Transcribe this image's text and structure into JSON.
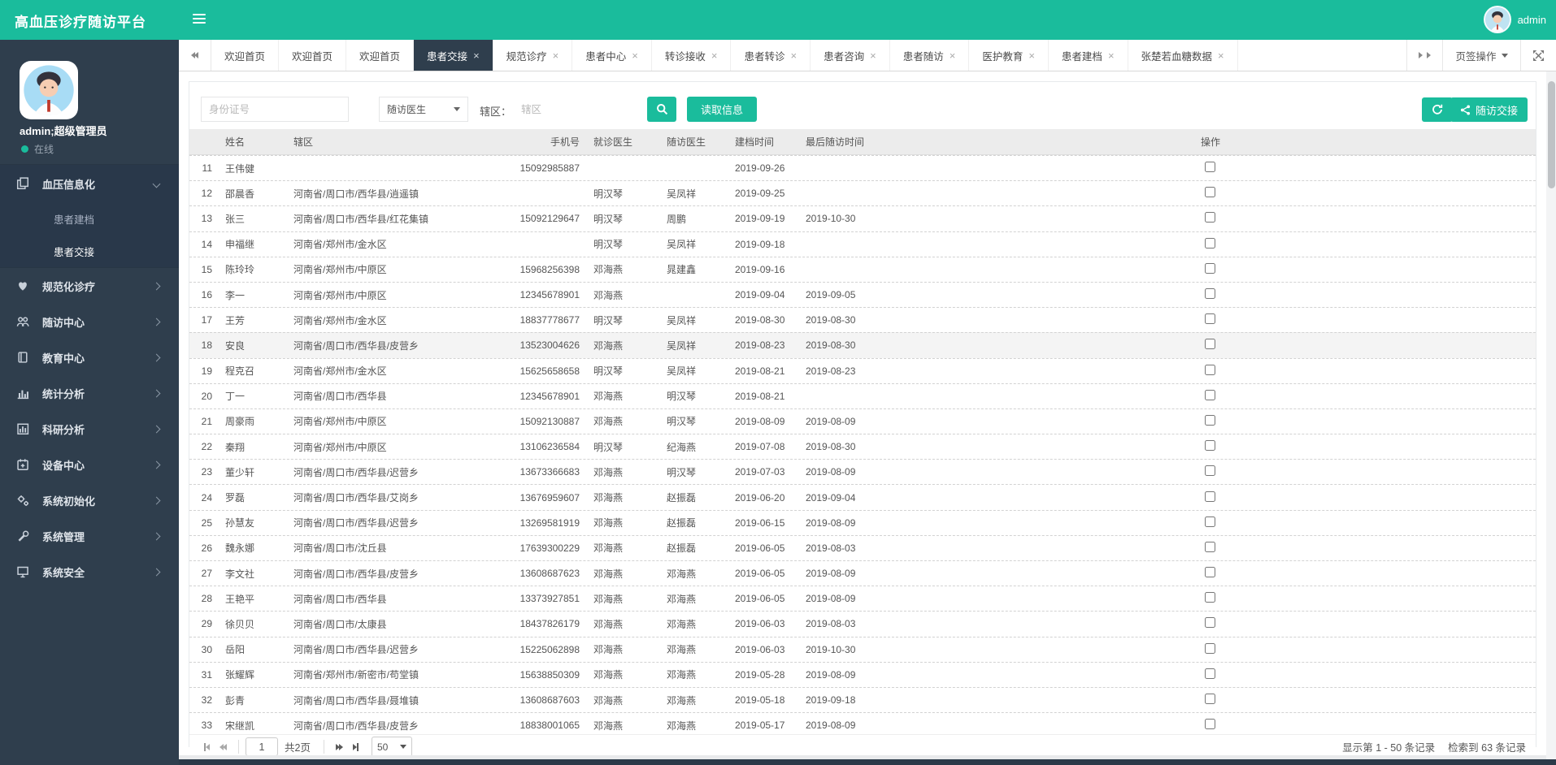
{
  "app": {
    "title": "高血压诊疗随访平台",
    "top_user": "admin"
  },
  "sidebar": {
    "user_name": "admin;超级管理员",
    "status": "在线",
    "menu": [
      {
        "label": "血压信息化",
        "icon": "files-icon",
        "expanded": true,
        "children": [
          {
            "label": "患者建档",
            "active": false
          },
          {
            "label": "患者交接",
            "active": true
          }
        ]
      },
      {
        "label": "规范化诊疗",
        "icon": "heartbeat-icon"
      },
      {
        "label": "随访中心",
        "icon": "users-icon"
      },
      {
        "label": "教育中心",
        "icon": "book-icon"
      },
      {
        "label": "统计分析",
        "icon": "bar-chart-icon"
      },
      {
        "label": "科研分析",
        "icon": "chart-icon"
      },
      {
        "label": "设备中心",
        "icon": "calendar-icon"
      },
      {
        "label": "系统初始化",
        "icon": "gears-icon"
      },
      {
        "label": "系统管理",
        "icon": "wrench-icon"
      },
      {
        "label": "系统安全",
        "icon": "desktop-icon"
      }
    ]
  },
  "tabs": {
    "items": [
      {
        "label": "欢迎首页",
        "closable": false,
        "active": false
      },
      {
        "label": "欢迎首页",
        "closable": false,
        "active": false
      },
      {
        "label": "欢迎首页",
        "closable": false,
        "active": false
      },
      {
        "label": "患者交接",
        "closable": true,
        "active": true
      },
      {
        "label": "规范诊疗",
        "closable": true,
        "active": false
      },
      {
        "label": "患者中心",
        "closable": true,
        "active": false
      },
      {
        "label": "转诊接收",
        "closable": true,
        "active": false
      },
      {
        "label": "患者转诊",
        "closable": true,
        "active": false
      },
      {
        "label": "患者咨询",
        "closable": true,
        "active": false
      },
      {
        "label": "患者随访",
        "closable": true,
        "active": false
      },
      {
        "label": "医护教育",
        "closable": true,
        "active": false
      },
      {
        "label": "患者建档",
        "closable": true,
        "active": false
      },
      {
        "label": "张楚若血糖数据",
        "closable": true,
        "active": false
      }
    ],
    "actions_label": "页签操作"
  },
  "toolbar": {
    "id_placeholder": "身份证号",
    "doctor_select_value": "随访医生",
    "region_label": "辖区：",
    "region_placeholder": "辖区",
    "read_info_label": "读取信息",
    "handover_label": "随访交接"
  },
  "colors": {
    "accent": "#1abc9c",
    "sidebar": "#2f3e4d",
    "header_bg": "#ececec"
  },
  "table": {
    "columns": [
      "姓名",
      "辖区",
      "手机号",
      "就诊医生",
      "随访医生",
      "建档时间",
      "最后随访时间",
      "操作"
    ],
    "rows": [
      {
        "n": "11",
        "name": "王伟健",
        "region": "",
        "phone": "15092985887",
        "doc": "",
        "fdoc": "",
        "created": "2019-09-26",
        "last": ""
      },
      {
        "n": "12",
        "name": "邵晨香",
        "region": "河南省/周口市/西华县/逍遥镇",
        "phone": "",
        "doc": "明汉琴",
        "fdoc": "吴凤祥",
        "created": "2019-09-25",
        "last": ""
      },
      {
        "n": "13",
        "name": "张三",
        "region": "河南省/周口市/西华县/红花集镇",
        "phone": "15092129647",
        "doc": "明汉琴",
        "fdoc": "周鹏",
        "created": "2019-09-19",
        "last": "2019-10-30"
      },
      {
        "n": "14",
        "name": "申福继",
        "region": "河南省/郑州市/金水区",
        "phone": "",
        "doc": "明汉琴",
        "fdoc": "吴凤祥",
        "created": "2019-09-18",
        "last": ""
      },
      {
        "n": "15",
        "name": "陈玲玲",
        "region": "河南省/郑州市/中原区",
        "phone": "15968256398",
        "doc": "邓海燕",
        "fdoc": "晁建鑫",
        "created": "2019-09-16",
        "last": ""
      },
      {
        "n": "16",
        "name": "李一",
        "region": "河南省/郑州市/中原区",
        "phone": "12345678901",
        "doc": "邓海燕",
        "fdoc": "",
        "created": "2019-09-04",
        "last": "2019-09-05"
      },
      {
        "n": "17",
        "name": "王芳",
        "region": "河南省/郑州市/金水区",
        "phone": "18837778677",
        "doc": "明汉琴",
        "fdoc": "吴凤祥",
        "created": "2019-08-30",
        "last": "2019-08-30"
      },
      {
        "n": "18",
        "name": "安良",
        "region": "河南省/周口市/西华县/皮营乡",
        "phone": "13523004626",
        "doc": "邓海燕",
        "fdoc": "吴凤祥",
        "created": "2019-08-23",
        "last": "2019-08-30",
        "hl": true
      },
      {
        "n": "19",
        "name": "程克召",
        "region": "河南省/郑州市/金水区",
        "phone": "15625658658",
        "doc": "明汉琴",
        "fdoc": "吴凤祥",
        "created": "2019-08-21",
        "last": "2019-08-23"
      },
      {
        "n": "20",
        "name": "丁一",
        "region": "河南省/周口市/西华县",
        "phone": "12345678901",
        "doc": "邓海燕",
        "fdoc": "明汉琴",
        "created": "2019-08-21",
        "last": ""
      },
      {
        "n": "21",
        "name": "周豪雨",
        "region": "河南省/郑州市/中原区",
        "phone": "15092130887",
        "doc": "邓海燕",
        "fdoc": "明汉琴",
        "created": "2019-08-09",
        "last": "2019-08-09"
      },
      {
        "n": "22",
        "name": "秦翔",
        "region": "河南省/郑州市/中原区",
        "phone": "13106236584",
        "doc": "明汉琴",
        "fdoc": "纪海燕",
        "created": "2019-07-08",
        "last": "2019-08-30"
      },
      {
        "n": "23",
        "name": "董少轩",
        "region": "河南省/周口市/西华县/迟营乡",
        "phone": "13673366683",
        "doc": "邓海燕",
        "fdoc": "明汉琴",
        "created": "2019-07-03",
        "last": "2019-08-09"
      },
      {
        "n": "24",
        "name": "罗磊",
        "region": "河南省/周口市/西华县/艾岗乡",
        "phone": "13676959607",
        "doc": "邓海燕",
        "fdoc": "赵振磊",
        "created": "2019-06-20",
        "last": "2019-09-04"
      },
      {
        "n": "25",
        "name": "孙慧友",
        "region": "河南省/周口市/西华县/迟营乡",
        "phone": "13269581919",
        "doc": "邓海燕",
        "fdoc": "赵振磊",
        "created": "2019-06-15",
        "last": "2019-08-09"
      },
      {
        "n": "26",
        "name": "魏永娜",
        "region": "河南省/周口市/沈丘县",
        "phone": "17639300229",
        "doc": "邓海燕",
        "fdoc": "赵振磊",
        "created": "2019-06-05",
        "last": "2019-08-03"
      },
      {
        "n": "27",
        "name": "李文社",
        "region": "河南省/周口市/西华县/皮营乡",
        "phone": "13608687623",
        "doc": "邓海燕",
        "fdoc": "邓海燕",
        "created": "2019-06-05",
        "last": "2019-08-09"
      },
      {
        "n": "28",
        "name": "王艳平",
        "region": "河南省/周口市/西华县",
        "phone": "13373927851",
        "doc": "邓海燕",
        "fdoc": "邓海燕",
        "created": "2019-06-05",
        "last": "2019-08-09"
      },
      {
        "n": "29",
        "name": "徐贝贝",
        "region": "河南省/周口市/太康县",
        "phone": "18437826179",
        "doc": "邓海燕",
        "fdoc": "邓海燕",
        "created": "2019-06-03",
        "last": "2019-08-03"
      },
      {
        "n": "30",
        "name": "岳阳",
        "region": "河南省/周口市/西华县/迟营乡",
        "phone": "15225062898",
        "doc": "邓海燕",
        "fdoc": "邓海燕",
        "created": "2019-06-03",
        "last": "2019-10-30"
      },
      {
        "n": "31",
        "name": "张耀辉",
        "region": "河南省/郑州市/新密市/苟堂镇",
        "phone": "15638850309",
        "doc": "邓海燕",
        "fdoc": "邓海燕",
        "created": "2019-05-28",
        "last": "2019-08-09"
      },
      {
        "n": "32",
        "name": "彭青",
        "region": "河南省/周口市/西华县/聂堆镇",
        "phone": "13608687603",
        "doc": "邓海燕",
        "fdoc": "邓海燕",
        "created": "2019-05-18",
        "last": "2019-09-18"
      },
      {
        "n": "33",
        "name": "宋继凯",
        "region": "河南省/周口市/西华县/皮营乡",
        "phone": "18838001065",
        "doc": "邓海燕",
        "fdoc": "邓海燕",
        "created": "2019-05-17",
        "last": "2019-08-09"
      }
    ]
  },
  "pagination": {
    "page_value": "1",
    "total_label": "共2页",
    "page_size": "50",
    "summary_range": "显示第 1 - 50 条记录",
    "summary_total": "检索到 63 条记录"
  }
}
